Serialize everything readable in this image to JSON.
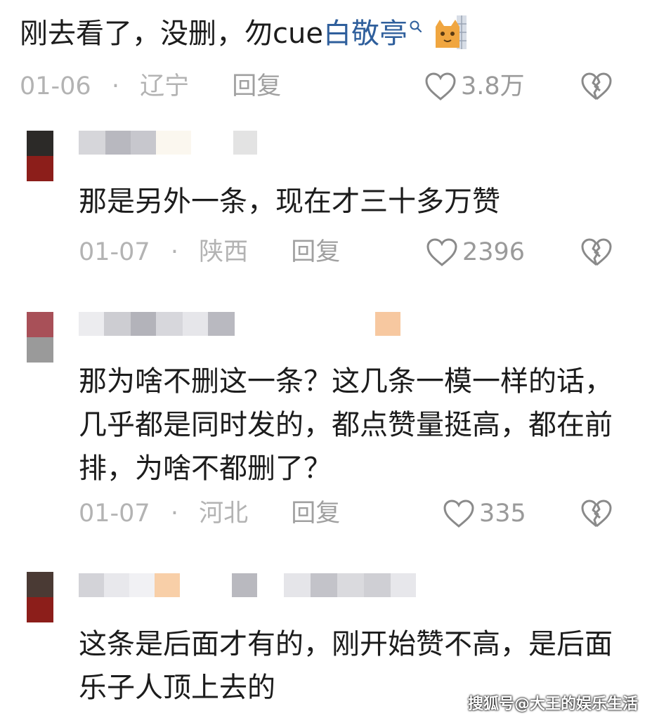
{
  "top_comment": {
    "text": "刚去看了，没删，勿cue",
    "link": "白敬亭",
    "date": "01-06",
    "location": "辽宁",
    "reply_label": "回复",
    "likes": "3.8万"
  },
  "replies": [
    {
      "text": "那是另外一条，现在才三十多万赞",
      "date": "01-07",
      "location": "陕西",
      "reply_label": "回复",
      "likes": "2396"
    },
    {
      "text": "那为啥不删这一条？这几条一模一样的话，几乎都是同时发的，都点赞量挺高，都在前排，为啥不都删了？",
      "date": "01-07",
      "location": "河北",
      "reply_label": "回复",
      "likes": "335"
    },
    {
      "text": "这条是后面才有的，刚开始赞不高，是后面乐子人顶上去的"
    }
  ],
  "separator": "·",
  "watermark": "搜狐号@大王的娱乐生活",
  "colors": {
    "link": "#2f5f9c",
    "meta": "#b3b3b3",
    "icon": "#9a9a9a"
  }
}
